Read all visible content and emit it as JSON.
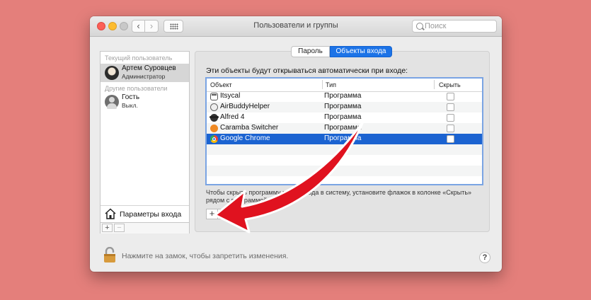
{
  "window": {
    "title": "Пользователи и группы"
  },
  "toolbar": {
    "back": "‹",
    "forward": "›",
    "search_placeholder": "Поиск"
  },
  "sidebar": {
    "current_user_header": "Текущий пользователь",
    "current_user": {
      "name": "Артем Суровцев",
      "role": "Администратор"
    },
    "other_users_header": "Другие пользователи",
    "other_user": {
      "name": "Гость",
      "status": "Выкл."
    },
    "login_options": "Параметры входа",
    "add": "+",
    "remove": "−"
  },
  "tabs": [
    {
      "label": "Пароль",
      "active": false
    },
    {
      "label": "Объекты входа",
      "active": true
    }
  ],
  "login_items": {
    "caption": "Эти объекты будут открываться автоматически при входе:",
    "columns": [
      "Объект",
      "Тип",
      "Скрыть"
    ],
    "rows": [
      {
        "name": "Itsycal",
        "type": "Программа",
        "icon": "itsycal-icon",
        "selected": false
      },
      {
        "name": "AirBuddyHelper",
        "type": "Программа",
        "icon": "airbuddy-icon",
        "selected": false
      },
      {
        "name": "Alfred 4",
        "type": "Программа",
        "icon": "alfred-icon",
        "selected": false
      },
      {
        "name": "Caramba Switcher",
        "type": "Программа",
        "icon": "caramba-icon",
        "selected": false
      },
      {
        "name": "Google Chrome",
        "type": "Программа",
        "icon": "chrome-icon",
        "selected": true
      }
    ],
    "hint": "Чтобы скрыть программу после входа в систему, установите флажок в колонке «Скрыть» рядом с программой.",
    "add": "+",
    "remove": "−"
  },
  "footer": {
    "lock_text": "Нажмите на замок, чтобы запретить изменения.",
    "help": "?"
  },
  "colors": {
    "background": "#e47f7b",
    "accent": "#1c73e7",
    "selection": "#1b63d1",
    "arrow": "#e0121f"
  }
}
